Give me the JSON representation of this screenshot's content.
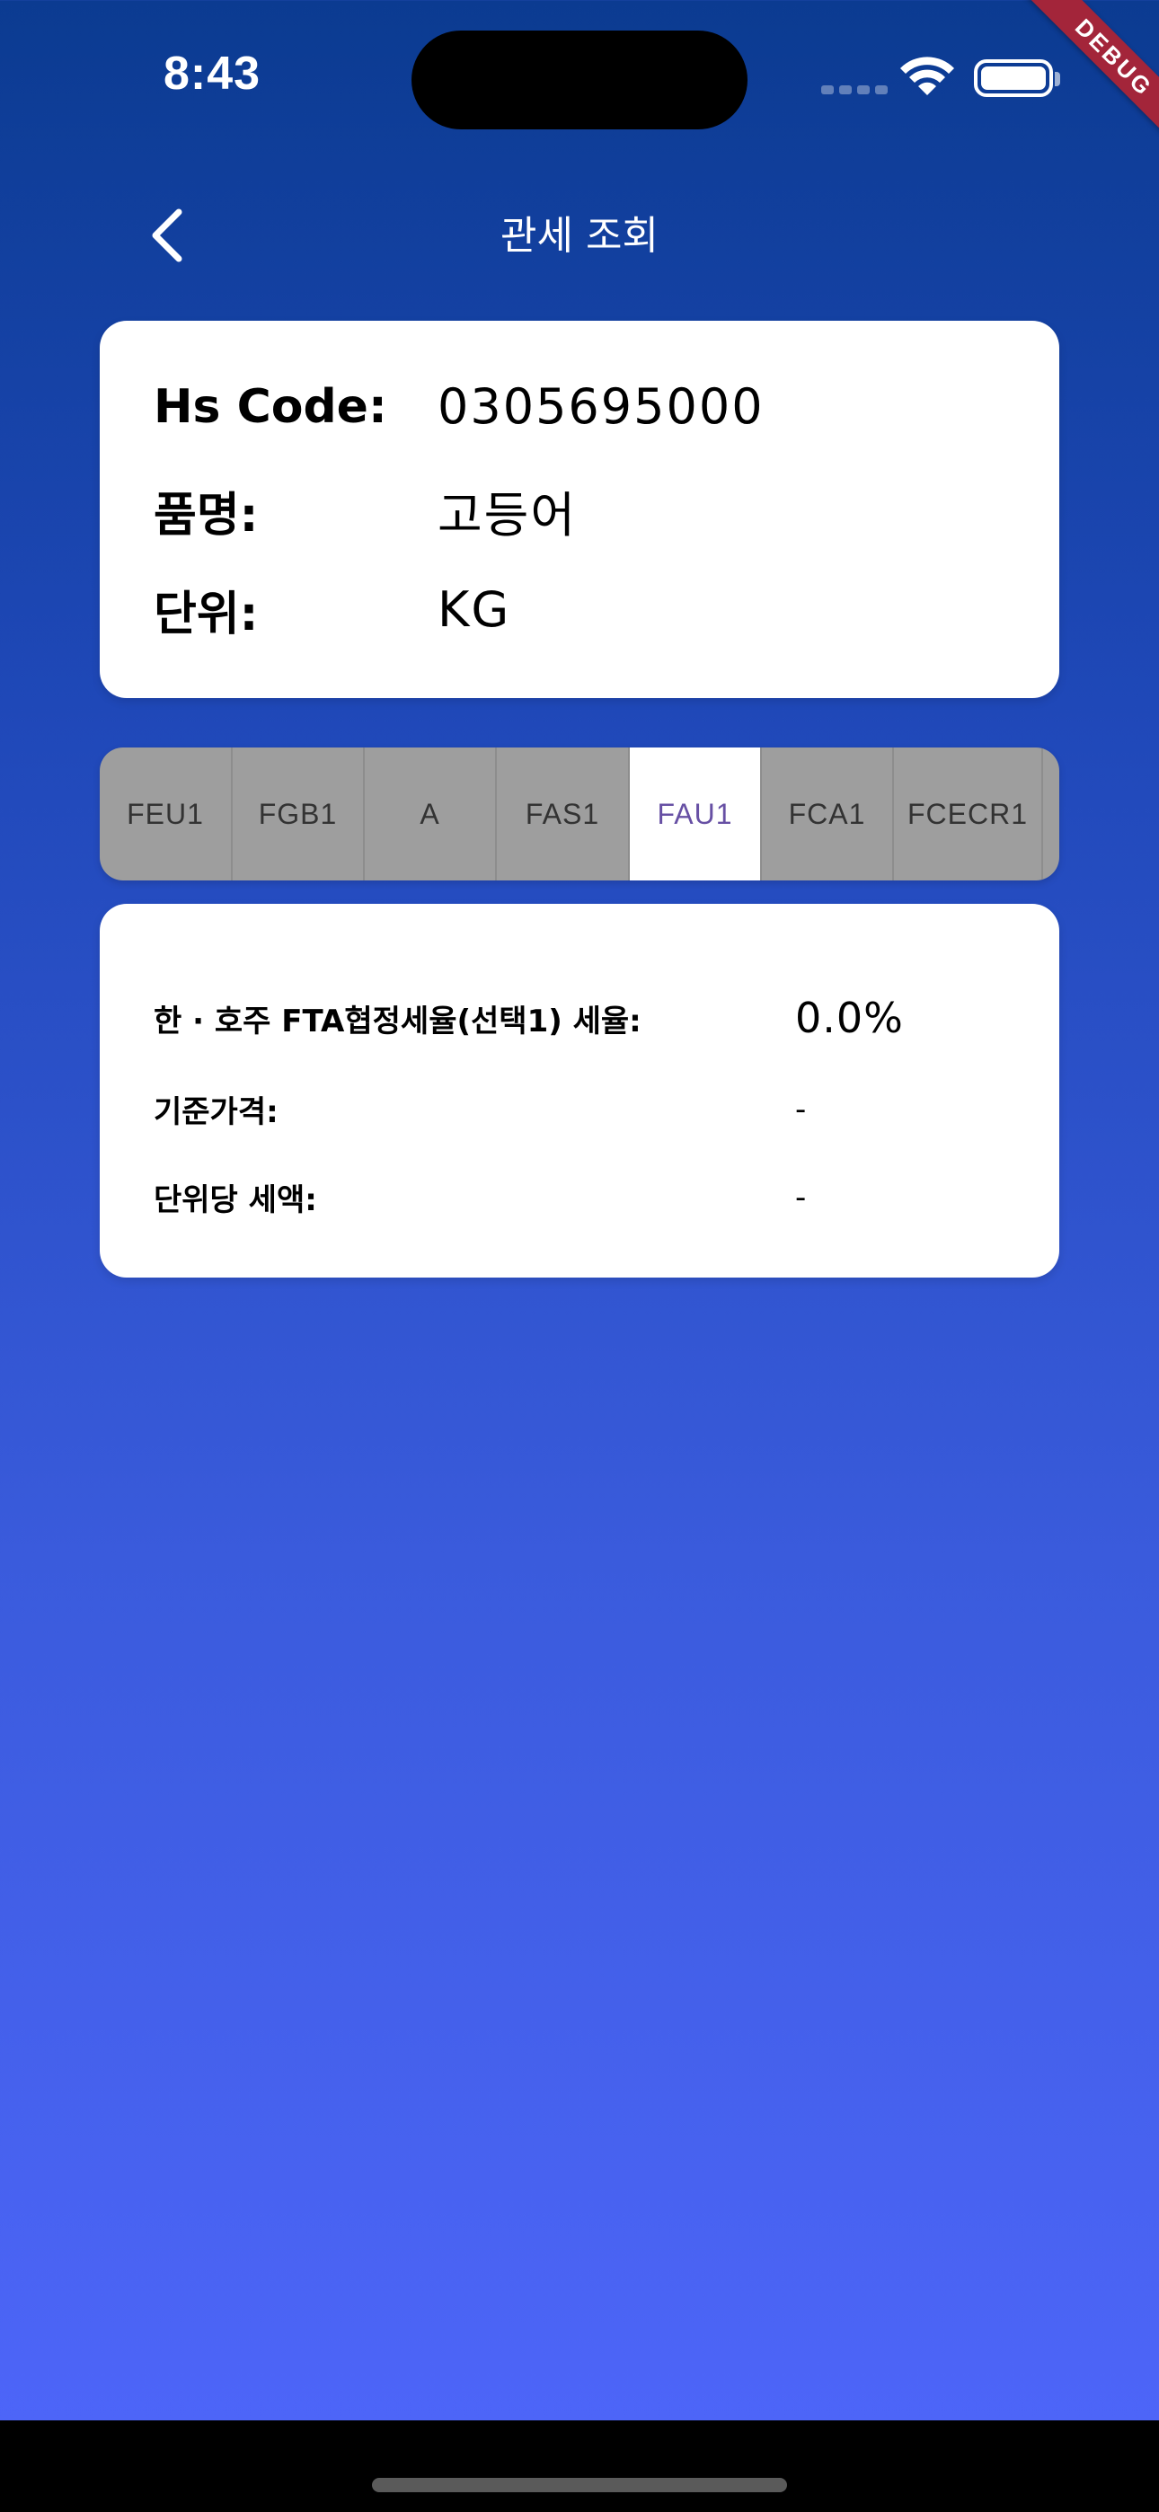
{
  "status_bar": {
    "time": "8:43"
  },
  "debug_banner": "DEBUG",
  "header": {
    "title": "관세 조회"
  },
  "item_info": {
    "hs_code_label": "Hs Code:",
    "hs_code_value": "0305695000",
    "name_label": "품명:",
    "name_value": "고등어",
    "unit_label": "단위:",
    "unit_value": "KG"
  },
  "tabs": [
    {
      "label": "FEU1",
      "selected": false
    },
    {
      "label": "FGB1",
      "selected": false
    },
    {
      "label": "A",
      "selected": false
    },
    {
      "label": "FAS1",
      "selected": false
    },
    {
      "label": "FAU1",
      "selected": true
    },
    {
      "label": "FCA1",
      "selected": false
    },
    {
      "label": "FCECR1",
      "selected": false
    }
  ],
  "tariff_detail": {
    "rate_label": "한 · 호주 FTA협정세율(선택1) 세율:",
    "rate_value": "0.0%",
    "base_price_label": "기준가격:",
    "base_price_value": "-",
    "per_unit_tax_label": "단위당 세액:",
    "per_unit_tax_value": "-"
  },
  "colors": {
    "gradient_top": "#0b3b91",
    "gradient_bottom": "#4f66fb",
    "tab_selected_text": "#6750a4",
    "tab_background": "#9e9e9e",
    "debug_ribbon": "#a3253a"
  }
}
